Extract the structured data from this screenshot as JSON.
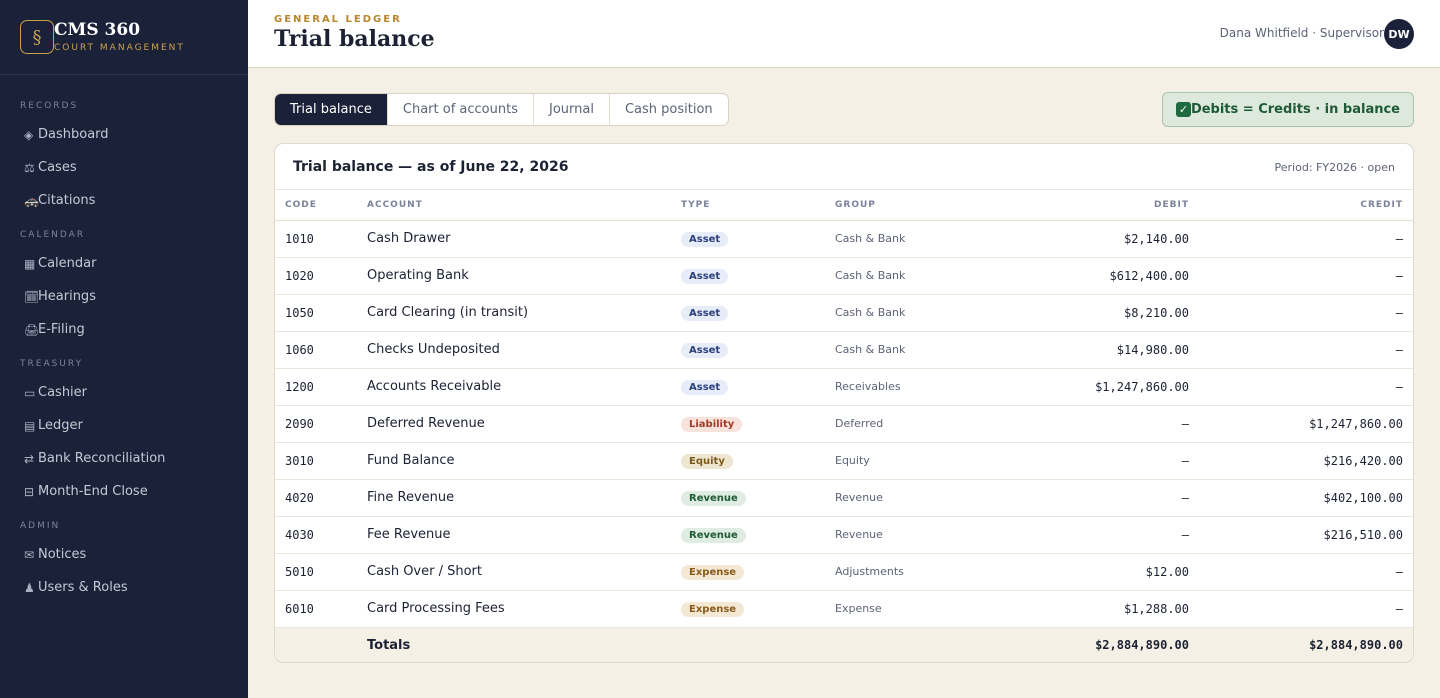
{
  "sidebar": {
    "logo_glyph": "§",
    "brand_name": "CMS 360",
    "brand_sub": "COURT MANAGEMENT",
    "sections": [
      {
        "title": "RECORDS",
        "items": [
          {
            "icon": "◈",
            "icon_name": "dashboard-icon",
            "label": "Dashboard"
          },
          {
            "icon": "⚖",
            "icon_name": "scales-icon",
            "label": "Cases"
          },
          {
            "icon": "🚓",
            "icon_name": "police-car-icon",
            "label": "Citations"
          }
        ]
      },
      {
        "title": "CALENDAR",
        "items": [
          {
            "icon": "▦",
            "icon_name": "calendar-icon",
            "label": "Calendar"
          },
          {
            "icon": "🗓",
            "icon_name": "hearings-icon",
            "label": "Hearings"
          },
          {
            "icon": "🖨",
            "icon_name": "printer-icon",
            "label": "E-Filing"
          }
        ]
      },
      {
        "title": "TREASURY",
        "items": [
          {
            "icon": "▭",
            "icon_name": "cashier-icon",
            "label": "Cashier"
          },
          {
            "icon": "▤",
            "icon_name": "ledger-icon",
            "label": "Ledger"
          },
          {
            "icon": "⇄",
            "icon_name": "reconcile-icon",
            "label": "Bank Reconciliation"
          },
          {
            "icon": "⊟",
            "icon_name": "month-end-icon",
            "label": "Month-End Close"
          }
        ]
      },
      {
        "title": "ADMIN",
        "items": [
          {
            "icon": "✉",
            "icon_name": "envelope-icon",
            "label": "Notices"
          },
          {
            "icon": "♟",
            "icon_name": "users-icon",
            "label": "Users & Roles"
          }
        ]
      }
    ]
  },
  "header": {
    "eyebrow": "GENERAL LEDGER",
    "title": "Trial balance",
    "user": "Dana Whitfield · Supervisor",
    "avatar_initials": "DW"
  },
  "tabs": [
    {
      "label": "Trial balance",
      "active": true
    },
    {
      "label": "Chart of accounts",
      "active": false
    },
    {
      "label": "Journal",
      "active": false
    },
    {
      "label": "Cash position",
      "active": false
    }
  ],
  "balance_status": {
    "check": "✓",
    "text": "Debits = Credits · in balance"
  },
  "card": {
    "title": "Trial balance — as of June 22, 2026",
    "period": "Period: FY2026 · open"
  },
  "table": {
    "columns": [
      "CODE",
      "ACCOUNT",
      "TYPE",
      "GROUP",
      "DEBIT",
      "CREDIT"
    ],
    "rows": [
      {
        "code": "1010",
        "account": "Cash Drawer",
        "type": "Asset",
        "group": "Cash & Bank",
        "debit": "$2,140.00",
        "credit": "—"
      },
      {
        "code": "1020",
        "account": "Operating Bank",
        "type": "Asset",
        "group": "Cash & Bank",
        "debit": "$612,400.00",
        "credit": "—"
      },
      {
        "code": "1050",
        "account": "Card Clearing (in transit)",
        "type": "Asset",
        "group": "Cash & Bank",
        "debit": "$8,210.00",
        "credit": "—"
      },
      {
        "code": "1060",
        "account": "Checks Undeposited",
        "type": "Asset",
        "group": "Cash & Bank",
        "debit": "$14,980.00",
        "credit": "—"
      },
      {
        "code": "1200",
        "account": "Accounts Receivable",
        "type": "Asset",
        "group": "Receivables",
        "debit": "$1,247,860.00",
        "credit": "—"
      },
      {
        "code": "2090",
        "account": "Deferred Revenue",
        "type": "Liability",
        "group": "Deferred",
        "debit": "—",
        "credit": "$1,247,860.00"
      },
      {
        "code": "3010",
        "account": "Fund Balance",
        "type": "Equity",
        "group": "Equity",
        "debit": "—",
        "credit": "$216,420.00"
      },
      {
        "code": "4020",
        "account": "Fine Revenue",
        "type": "Revenue",
        "group": "Revenue",
        "debit": "—",
        "credit": "$402,100.00"
      },
      {
        "code": "4030",
        "account": "Fee Revenue",
        "type": "Revenue",
        "group": "Revenue",
        "debit": "—",
        "credit": "$216,510.00"
      },
      {
        "code": "5010",
        "account": "Cash Over / Short",
        "type": "Expense",
        "group": "Adjustments",
        "debit": "$12.00",
        "credit": "—"
      },
      {
        "code": "6010",
        "account": "Card Processing Fees",
        "type": "Expense",
        "group": "Expense",
        "debit": "$1,288.00",
        "credit": "—"
      }
    ],
    "totals": {
      "label": "Totals",
      "debit": "$2,884,890.00",
      "credit": "$2,884,890.00"
    }
  }
}
